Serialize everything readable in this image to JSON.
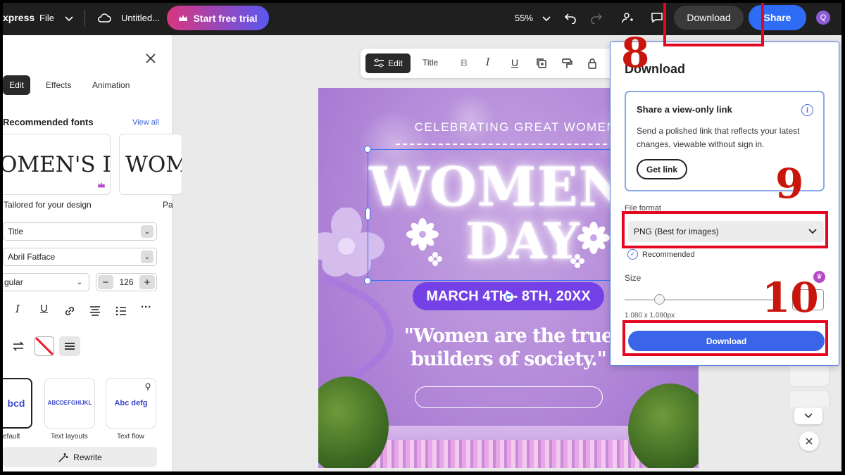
{
  "topbar": {
    "logo": "xpress",
    "file_menu": "File",
    "doc_title": "Untitled...",
    "trial_label": "Start free trial",
    "zoom": "55%",
    "download_label": "Download",
    "share_label": "Share",
    "avatar_initial": "Q"
  },
  "panel": {
    "tabs": [
      "Edit",
      "Effects",
      "Animation"
    ],
    "recommended_label": "Recommended fonts",
    "view_all": "View all",
    "font_card_1": "OMEN'S D",
    "font_card_1_caption": "Tailored for your design",
    "font_card_2": "WOM",
    "font_card_2_caption": "Pa",
    "style_dropdown": "Title",
    "font_dropdown": "Abril Fatface",
    "weight_dropdown": "gular",
    "font_size": "126",
    "text_styles": [
      {
        "preview": "bcd",
        "label": "efault"
      },
      {
        "preview": "ABCDEFGHIJKL",
        "label": "Text layouts"
      },
      {
        "preview": "Abc defg",
        "label": "Text flow"
      }
    ],
    "rewrite_label": "Rewrite"
  },
  "canvas_toolbar": {
    "edit_label": "Edit",
    "title_label": "Title"
  },
  "poster": {
    "subtitle": "CELEBRATING GREAT WOMEN",
    "headline_1": "WOMEN'",
    "headline_2": "DAY",
    "date": "MARCH 4TH - 8TH, 20XX",
    "quote": "\"Women are the true builders of society.\""
  },
  "dialog": {
    "title": "Download",
    "share_card_title": "Share a view-only link",
    "share_card_desc": "Send a polished link that reflects your latest changes, viewable without sign in.",
    "get_link_label": "Get link",
    "file_format_label": "File format",
    "file_format_value": "PNG (Best for images)",
    "recommended_label": "Recommended",
    "size_label": "Size",
    "size_value": "1.080 x 1.080px",
    "download_button": "Download"
  },
  "annotations": {
    "step_8": "8",
    "step_9": "9",
    "step_10": "10",
    "color": "#e5061f"
  }
}
